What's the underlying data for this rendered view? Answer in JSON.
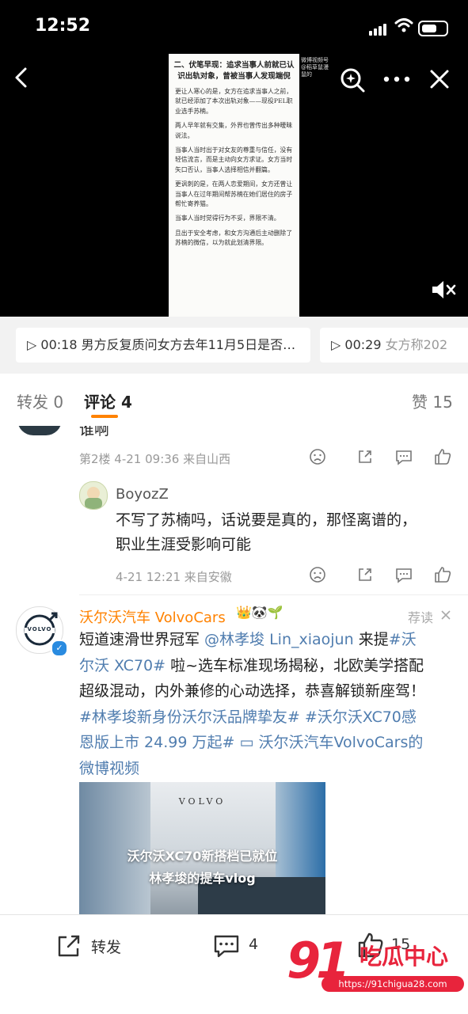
{
  "status": {
    "time": "12:52"
  },
  "video": {
    "heading": "二、伏笔早现：追求当事人前就已认识出轨对象，曾被当事人发现端倪",
    "paragraphs": [
      "更让人寒心的是，女方在追求当事人之前，就已经添加了本次出轨对象——现役PEL职业选手苏楠。",
      "两人早年就有交集，外界也曾传出多种暧昧说法。",
      "当事人当时出于对女友的尊重与信任，没有轻信流言，而是主动向女方求证。女方当时矢口否认，当事人选择相信并翻篇。",
      "更讽刺的是，在两人恋爱期间，女方还曾让当事人在过年期间帮苏楠在她们居住的房子帮忙寄养猫。",
      "当事人当时觉得行为不妥，界限不清。",
      "且出于安全考虑，和女方沟通后主动删除了苏楠的微信，以为就此划清界限。"
    ],
    "watermark": "微博视频号 @稻草鼠漫鼠的"
  },
  "chips": [
    {
      "time": "00:18",
      "text": "男方反复质问女方去年11月5日是否…"
    },
    {
      "time": "00:29",
      "text": "女方称202"
    }
  ],
  "tabs": {
    "repost": "转发 0",
    "comment": "评论 4",
    "like": "赞 15"
  },
  "comments": {
    "prev_text_tail": "谁啊",
    "floor2_meta": "第2楼  4-21 09:36  来自山西",
    "reply": {
      "user": "BoyozZ",
      "text": "不写了苏楠吗，话说要是真的，那怪离谱的，职业生涯受影响可能",
      "meta": "4-21 12:21  来自安徽"
    }
  },
  "ad": {
    "brand": "沃尔沃汽车 VolvoCars",
    "badges": "👑🐼🌱",
    "tag": "荐读",
    "avatar_text": "VOLVO",
    "text_plain1": "短道速滑世界冠军 ",
    "mention": "@林孝埈 Lin_xiaojun",
    "text_plain2": " 来提",
    "hashtag1": "#沃尔沃 XC70#",
    "text_plain3": " 啦~选车标准现场揭秘，北欧美学搭配超级混动，内外兼修的心动选择，恭喜解锁新座驾！",
    "hashtag2": "#林孝埈新身份沃尔沃品牌挚友#",
    "hashtag3": "#沃尔沃XC70感恩版上市 24.99 万起#",
    "video_link": "沃尔沃汽车VolvoCars的微博视频",
    "thumb_brand": "VOLVO",
    "thumb_title1": "沃尔沃XC70新搭档已就位",
    "thumb_title2": "林孝埈的提车vlog"
  },
  "bottom": {
    "repost": "转发",
    "comment_count": "4",
    "like_count": "15"
  },
  "watermark_logo": {
    "number": "91",
    "name": "吃瓜中心",
    "url": "https://91chigua28.com"
  },
  "colors": {
    "accent": "#ff8200",
    "link": "#507daf",
    "brand_red": "#e8243c"
  }
}
